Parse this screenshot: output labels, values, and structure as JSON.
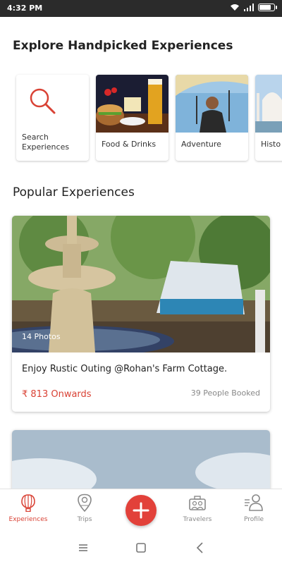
{
  "status_bar": {
    "time": "4:32 PM",
    "battery_level": 0.85
  },
  "explore": {
    "title": "Explore Handpicked Experiences",
    "categories": [
      {
        "label": "Search Experiences",
        "icon": "search-icon"
      },
      {
        "label": "Food & Drinks"
      },
      {
        "label": "Adventure"
      },
      {
        "label": "Histo"
      }
    ]
  },
  "popular": {
    "title": "Popular Experiences",
    "items": [
      {
        "photo_count": "14 Photos",
        "title": "Enjoy Rustic Outing @Rohan's Farm Cottage.",
        "price": "₹ 813 Onwards",
        "booked": "39 People Booked"
      }
    ]
  },
  "bottom_nav": {
    "items": [
      {
        "label": "Experiences",
        "icon": "hot-air-balloon-icon",
        "active": true
      },
      {
        "label": "Trips",
        "icon": "map-pin-icon"
      },
      {
        "label": "Travelers",
        "icon": "travelers-icon"
      },
      {
        "label": "Profile",
        "icon": "profile-icon"
      }
    ],
    "add_icon": "plus-icon"
  },
  "colors": {
    "accent": "#d94235",
    "add_button": "#e2413a"
  }
}
